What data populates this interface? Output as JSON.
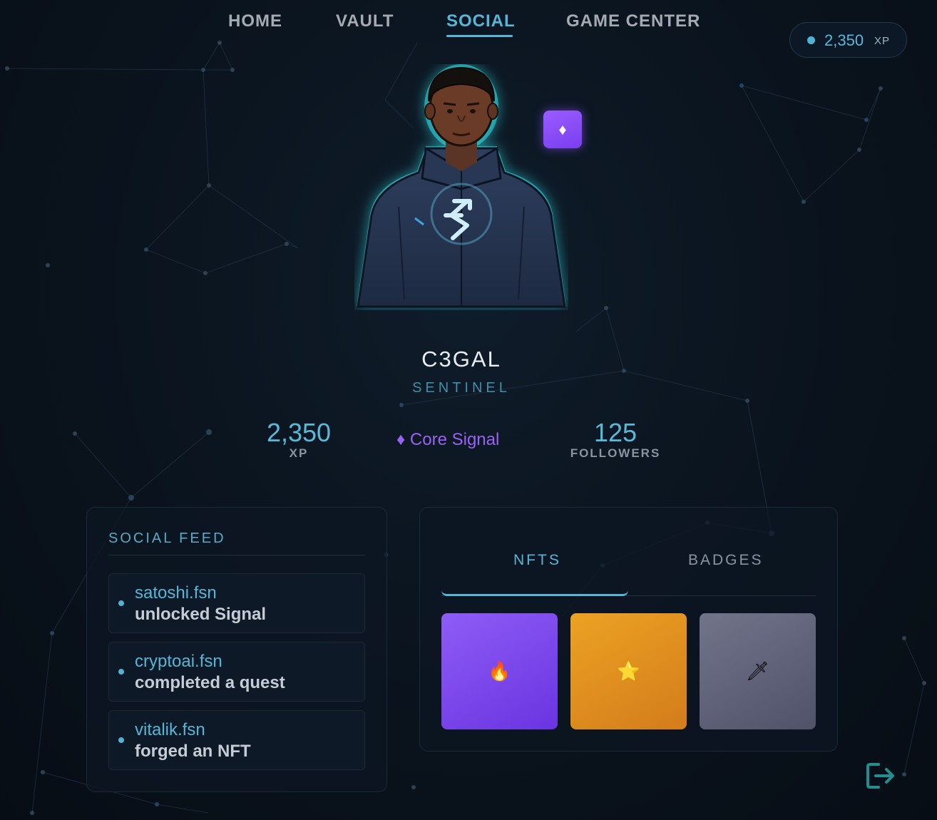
{
  "nav": {
    "tabs": [
      "HOME",
      "VAULT",
      "SOCIAL",
      "GAME CENTER"
    ],
    "active": "SOCIAL"
  },
  "xp_pill": {
    "value": "2,350",
    "unit": "XP"
  },
  "badge_icon": "diamond-icon",
  "badge_symbol": "♦",
  "profile": {
    "name": "C3GAL",
    "role": "SENTINEL"
  },
  "stats": {
    "xp_value": "2,350",
    "xp_label": "XP",
    "tier": "♦ Core Signal",
    "followers_value": "125",
    "followers_label": "FOLLOWERS"
  },
  "feed": {
    "title": "SOCIAL FEED",
    "items": [
      {
        "user": "satoshi.fsn",
        "action": "unlocked Signal"
      },
      {
        "user": "cryptoai.fsn",
        "action": "completed a quest"
      },
      {
        "user": "vitalik.fsn",
        "action": "forged an NFT"
      }
    ]
  },
  "collection": {
    "tabs": [
      "NFTS",
      "BADGES"
    ],
    "active_tab": "NFTS",
    "nfts": [
      {
        "icon": "fire-icon",
        "glyph": "🔥",
        "color": "#8048f0"
      },
      {
        "icon": "star-icon",
        "glyph": "⭐",
        "color": "#e0901c"
      },
      {
        "icon": "dagger-icon",
        "glyph": "🗡",
        "color": "#5e6074"
      }
    ]
  },
  "colors": {
    "accent": "#56b6d6",
    "purple": "#9a62f2",
    "background": "#0a121c"
  },
  "logout_icon": "logout-icon"
}
